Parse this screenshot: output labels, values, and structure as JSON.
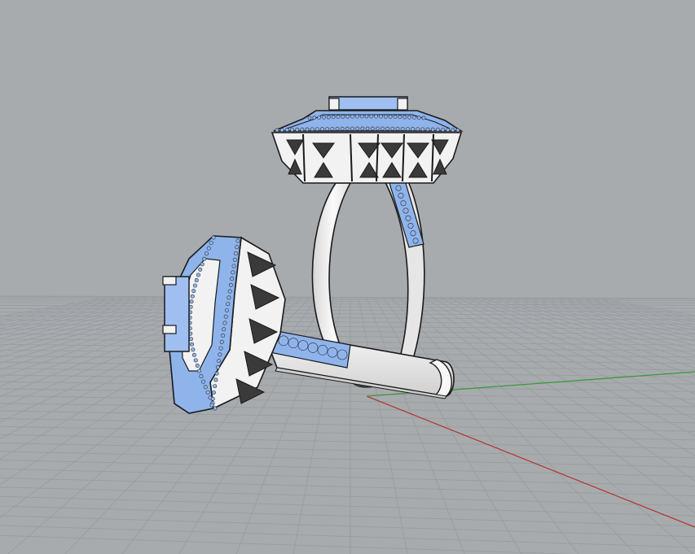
{
  "viewport": {
    "mode": "3d-perspective",
    "shading": "arctic-technical",
    "colors": {
      "background": "#a8abae",
      "grid_line": "#999ea3",
      "grid_major": "#8f9499",
      "x_axis": "#b03a3a",
      "y_axis": "#3a9a3a",
      "metal": "#f2f2f2",
      "metal_shadow": "#cfcfcf",
      "edge": "#1a1a1a",
      "gem": "#8fb4ec",
      "gem_dark": "#6e96d8"
    }
  },
  "objects": [
    {
      "name": "ring-standing",
      "gem_count_visible": "many"
    },
    {
      "name": "ring-lying",
      "gem_count_visible": "many"
    }
  ]
}
